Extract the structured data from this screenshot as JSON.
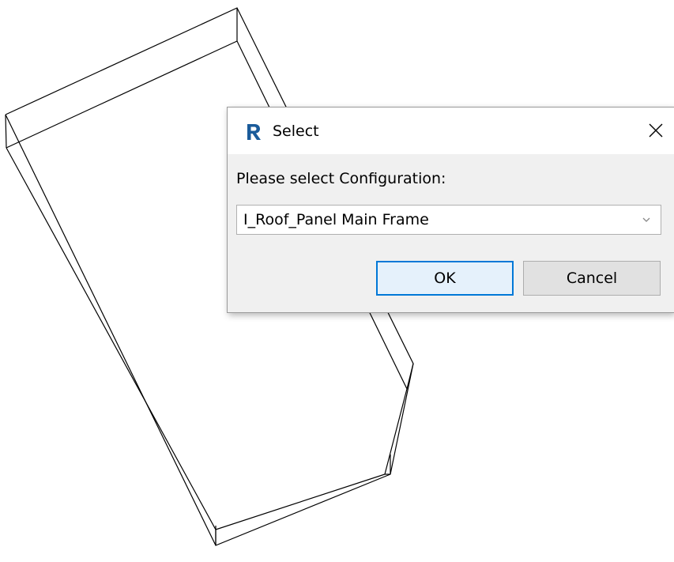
{
  "dialog": {
    "title": "Select",
    "app_icon": "revit-r-icon",
    "close_icon": "close-x-icon",
    "prompt": "Please select Configuration:",
    "configuration_select": {
      "selected": "I_Roof_Panel Main Frame",
      "chevron_icon": "chevron-down-icon"
    },
    "ok_label": "OK",
    "cancel_label": "Cancel"
  },
  "colors": {
    "accent": "#0078d7",
    "icon_blue": "#1a5b9a",
    "dialog_bg": "#f0f0f0"
  }
}
